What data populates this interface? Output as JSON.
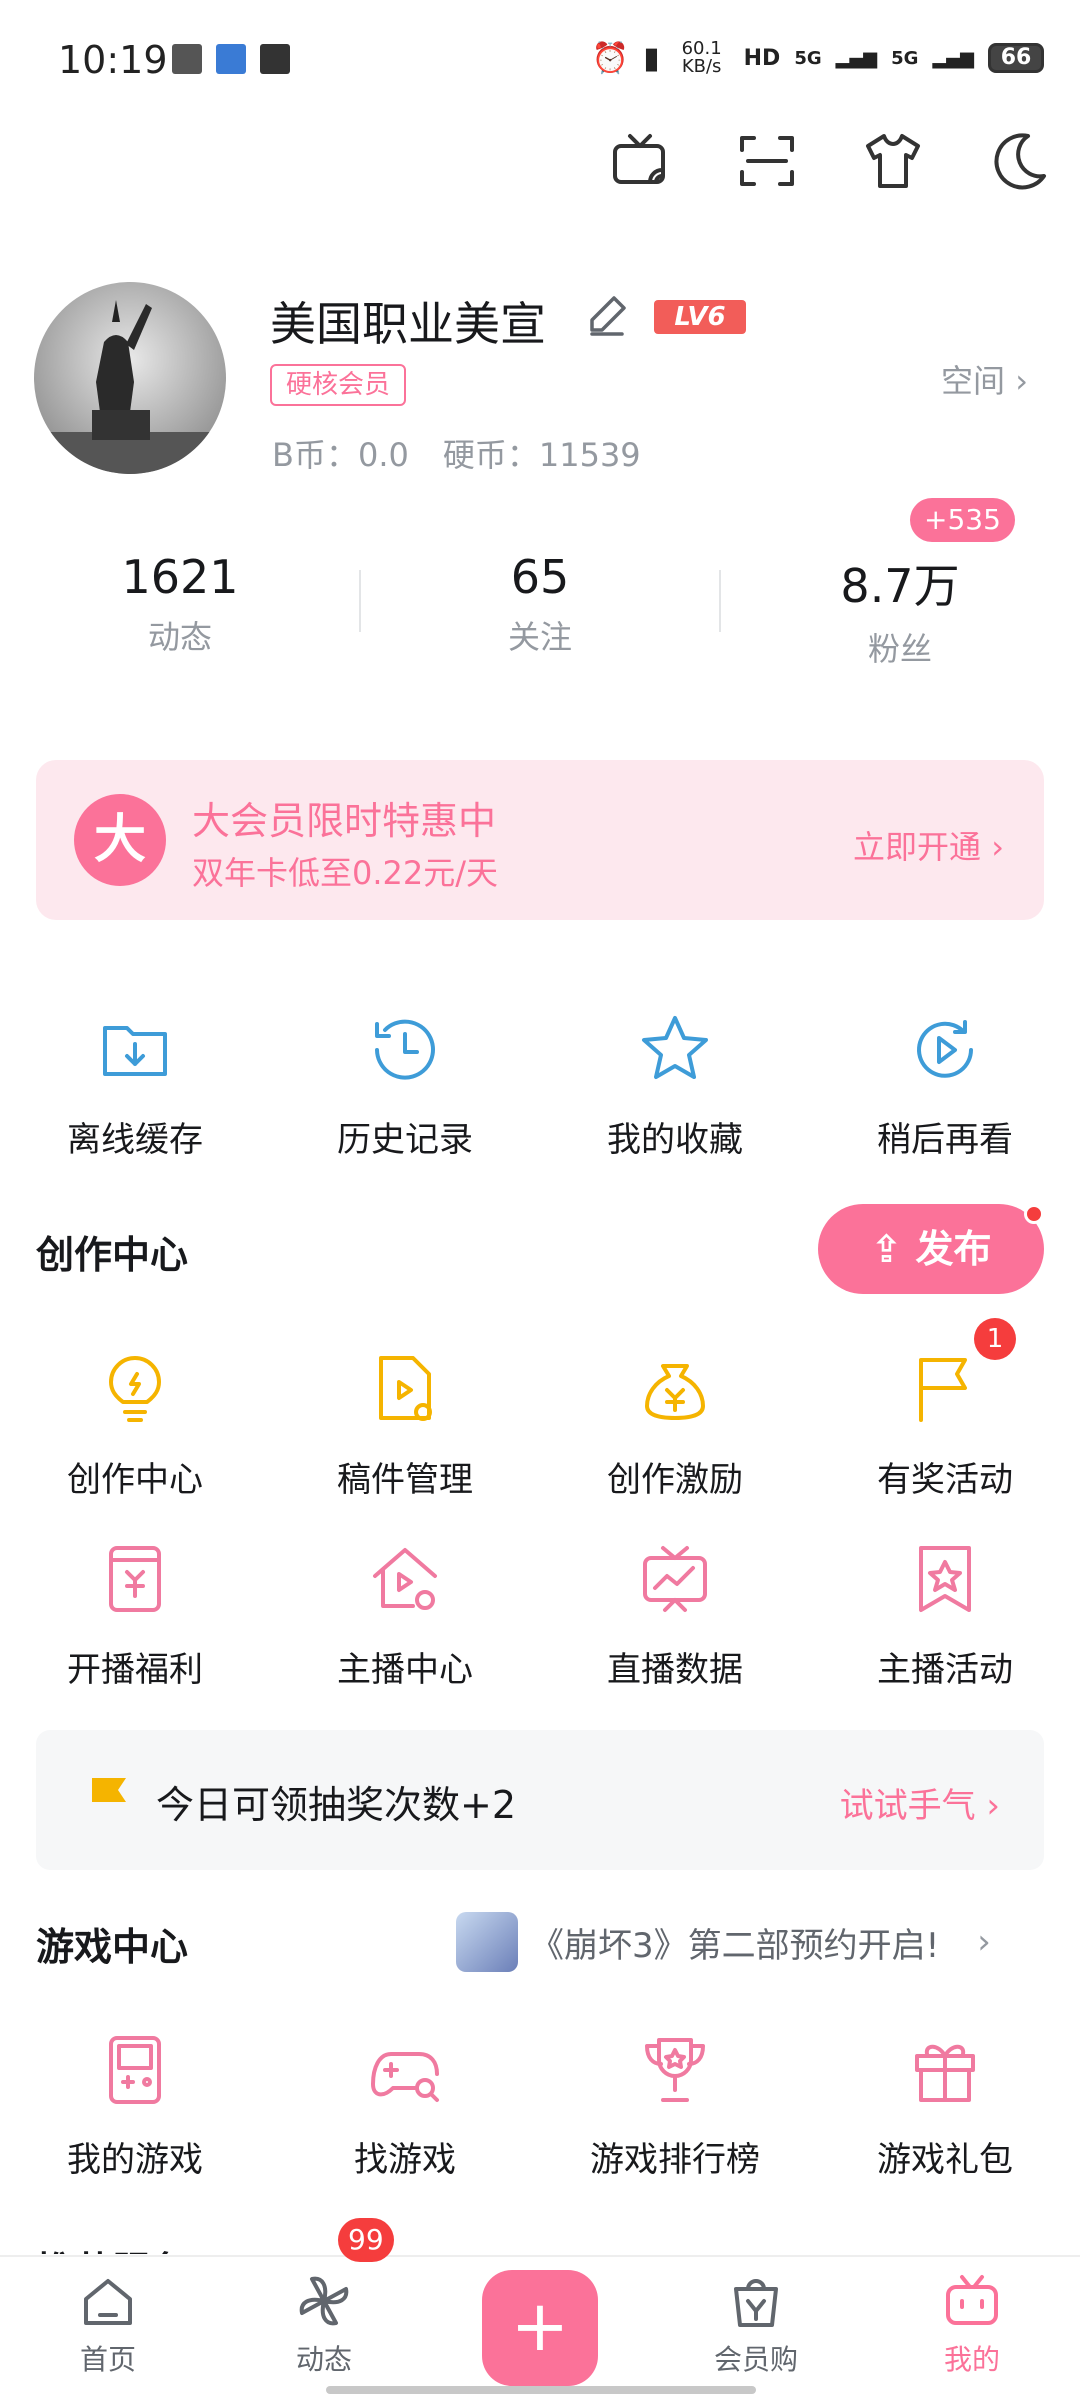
{
  "status": {
    "time": "10:19",
    "net_speed": "60.1 KB/s",
    "signal1": "5G",
    "signal2": "5G",
    "battery": "66"
  },
  "profile": {
    "name": "美国职业美宣",
    "level": "LV6",
    "vip_badge": "硬核会员",
    "b_coin": "B币：0.0",
    "coins": "硬币：11539",
    "space": "空间"
  },
  "stats": [
    {
      "value": "1621",
      "label": "动态"
    },
    {
      "value": "65",
      "label": "关注"
    },
    {
      "value": "8.7万",
      "label": "粉丝"
    }
  ],
  "fans_badge": "+535",
  "vip_banner": {
    "icon": "大",
    "title": "大会员限时特惠中",
    "subtitle": "双年卡低至0.22元/天",
    "action": "立即开通"
  },
  "quick": [
    "离线缓存",
    "历史记录",
    "我的收藏",
    "稍后再看"
  ],
  "creation": {
    "title": "创作中心",
    "publish": "发布",
    "row1": [
      "创作中心",
      "稿件管理",
      "创作激励",
      "有奖活动"
    ],
    "row2": [
      "开播福利",
      "主播中心",
      "直播数据",
      "主播活动"
    ],
    "activity_badge": "1"
  },
  "lottery": {
    "text": "今日可领抽奖次数+2",
    "action": "试试手气"
  },
  "games": {
    "title": "游戏中心",
    "promo": "《崩坏3》第二部预约开启!",
    "items": [
      "我的游戏",
      "找游戏",
      "游戏排行榜",
      "游戏礼包"
    ]
  },
  "next_section": "推荐服务",
  "tabs": [
    {
      "label": "首页"
    },
    {
      "label": "动态"
    },
    {
      "label": "会员购"
    },
    {
      "label": "我的"
    }
  ],
  "dynamic_badge": "99",
  "colors": {
    "accent": "#fb7299",
    "blue_icon": "#3e9cd8",
    "yellow_icon": "#f5b400"
  }
}
